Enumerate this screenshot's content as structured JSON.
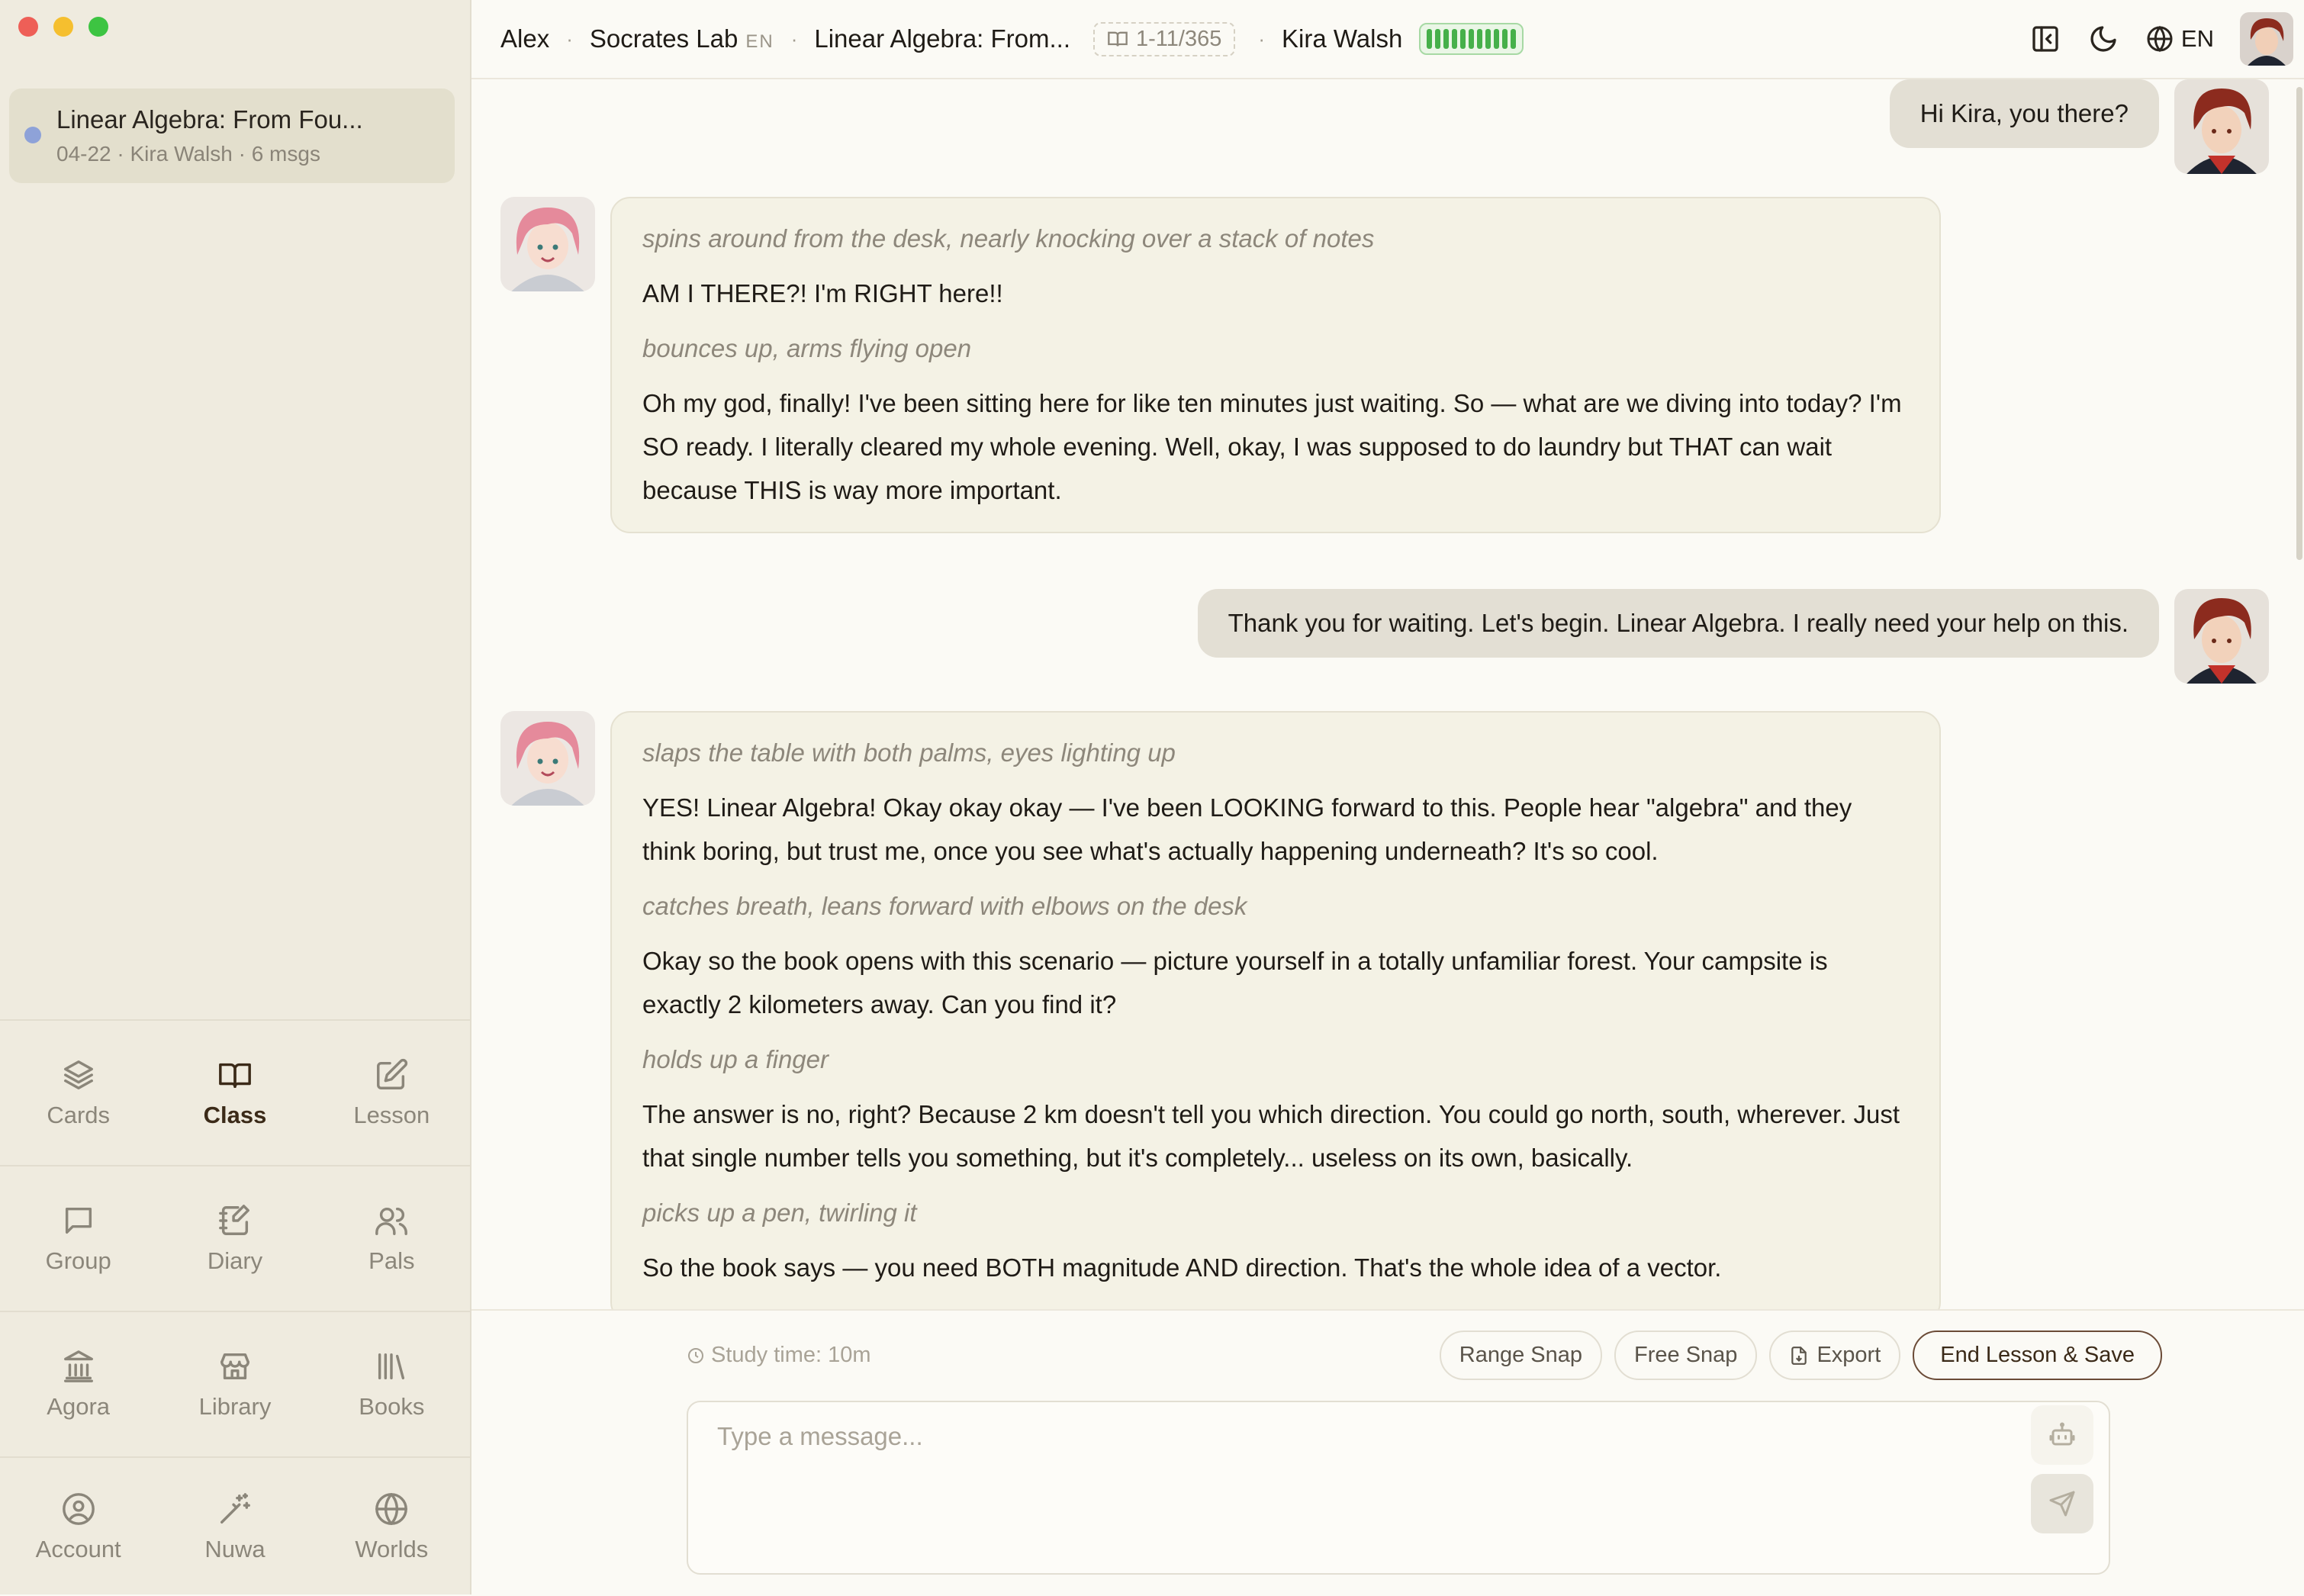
{
  "window": {
    "traffic_lights": {
      "close": "#ee5f57",
      "minimize": "#f5bf2f",
      "zoom": "#3dc442"
    }
  },
  "sidebar": {
    "sessions": [
      {
        "title": "Linear Algebra: From Fou...",
        "meta": "04-22 · Kira Walsh · 6 msgs",
        "dot_color": "#8ea2d8"
      }
    ],
    "nav": [
      {
        "label": "Cards",
        "icon": "layers-icon",
        "active": false
      },
      {
        "label": "Class",
        "icon": "book-open-icon",
        "active": true
      },
      {
        "label": "Lesson",
        "icon": "edit-icon",
        "active": false
      },
      {
        "label": "Group",
        "icon": "chat-bubble-icon",
        "active": false
      },
      {
        "label": "Diary",
        "icon": "notebook-pen-icon",
        "active": false
      },
      {
        "label": "Pals",
        "icon": "users-icon",
        "active": false
      },
      {
        "label": "Agora",
        "icon": "landmark-icon",
        "active": false
      },
      {
        "label": "Library",
        "icon": "store-icon",
        "active": false
      },
      {
        "label": "Books",
        "icon": "bookshelf-icon",
        "active": false
      },
      {
        "label": "Account",
        "icon": "user-circle-icon",
        "active": false
      },
      {
        "label": "Nuwa",
        "icon": "magic-wand-icon",
        "active": false
      },
      {
        "label": "Worlds",
        "icon": "globe-icon",
        "active": false
      }
    ]
  },
  "header": {
    "user": "Alex",
    "lab": "Socrates Lab",
    "lab_lang": "EN",
    "book": "Linear Algebra: From...",
    "pages": "1-11/365",
    "character": "Kira Walsh",
    "battery_level": 1.0,
    "language": "EN"
  },
  "messages": [
    {
      "role": "user",
      "text": "Hi Kira, you there?"
    },
    {
      "role": "ai",
      "parts": [
        {
          "kind": "action",
          "text": "spins around from the desk, nearly knocking over a stack of notes"
        },
        {
          "kind": "speech",
          "text": "AM I THERE?! I'm RIGHT here!!"
        },
        {
          "kind": "action",
          "text": "bounces up, arms flying open"
        },
        {
          "kind": "speech",
          "text": "Oh my god, finally! I've been sitting here for like ten minutes just waiting. So — what are we diving into today? I'm SO ready. I literally cleared my whole evening. Well, okay, I was supposed to do laundry but THAT can wait because THIS is way more important."
        }
      ]
    },
    {
      "role": "user",
      "text": "Thank you for waiting. Let's begin. Linear Algebra. I really need your help on this."
    },
    {
      "role": "ai",
      "parts": [
        {
          "kind": "action",
          "text": "slaps the table with both palms, eyes lighting up"
        },
        {
          "kind": "speech",
          "text": "YES! Linear Algebra! Okay okay okay — I've been LOOKING forward to this. People hear \"algebra\" and they think boring, but trust me, once you see what's actually happening underneath? It's so cool."
        },
        {
          "kind": "action",
          "text": "catches breath, leans forward with elbows on the desk"
        },
        {
          "kind": "speech",
          "text": "Okay so the book opens with this scenario — picture yourself in a totally unfamiliar forest. Your campsite is exactly 2 kilometers away. Can you find it?"
        },
        {
          "kind": "action",
          "text": "holds up a finger"
        },
        {
          "kind": "speech",
          "text": "The answer is no, right? Because 2 km doesn't tell you which direction. You could go north, south, wherever. Just that single number tells you something, but it's completely... useless on its own, basically."
        },
        {
          "kind": "action",
          "text": "picks up a pen, twirling it"
        },
        {
          "kind": "speech",
          "text": "So the book says — you need BOTH magnitude AND direction. That's the whole idea of a vector."
        }
      ]
    }
  ],
  "composer": {
    "study_time": "Study time: 10m",
    "buttons": {
      "range_snap": "Range Snap",
      "free_snap": "Free Snap",
      "export": "Export",
      "end_lesson": "End Lesson & Save"
    },
    "placeholder": "Type a message..."
  }
}
